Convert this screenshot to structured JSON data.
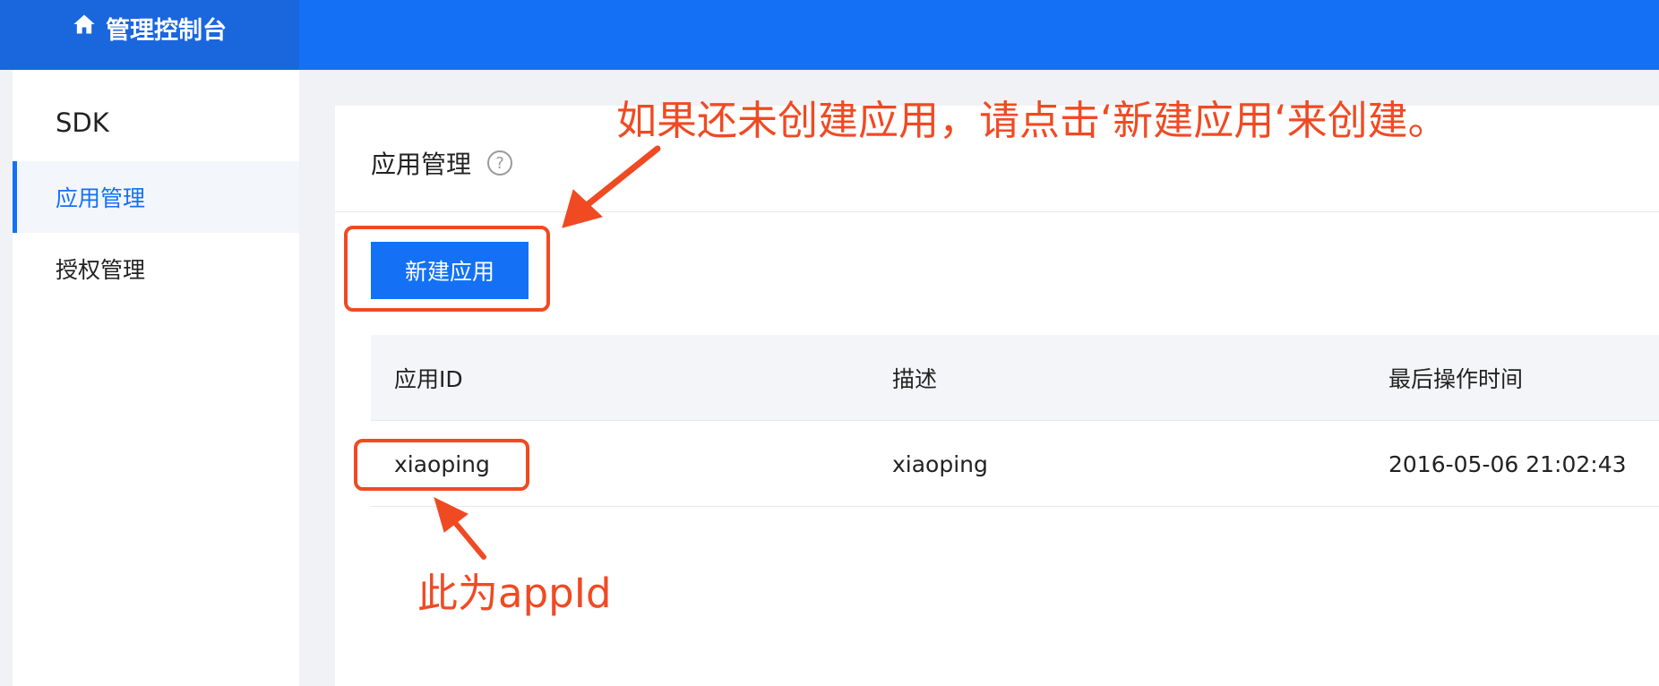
{
  "header": {
    "title": "管理控制台",
    "home_icon": "home-icon"
  },
  "sidebar": {
    "title": "SDK",
    "items": [
      {
        "label": "应用管理",
        "active": true
      },
      {
        "label": "授权管理",
        "active": false
      }
    ]
  },
  "main": {
    "title": "应用管理",
    "help_icon_text": "?",
    "new_button_label": "新建应用",
    "table": {
      "columns": [
        "应用ID",
        "描述",
        "最后操作时间"
      ],
      "rows": [
        [
          "xiaoping",
          "xiaoping",
          "2016-05-06 21:02:43"
        ]
      ]
    }
  },
  "annotations": {
    "top_text": "如果还未创建应用，请点击‘新建应用‘来创建。",
    "bottom_text": "此为appId",
    "color": "#f04a23"
  },
  "colors": {
    "brand_blue": "#1471f5",
    "brand_dark": "#1a66dd"
  }
}
